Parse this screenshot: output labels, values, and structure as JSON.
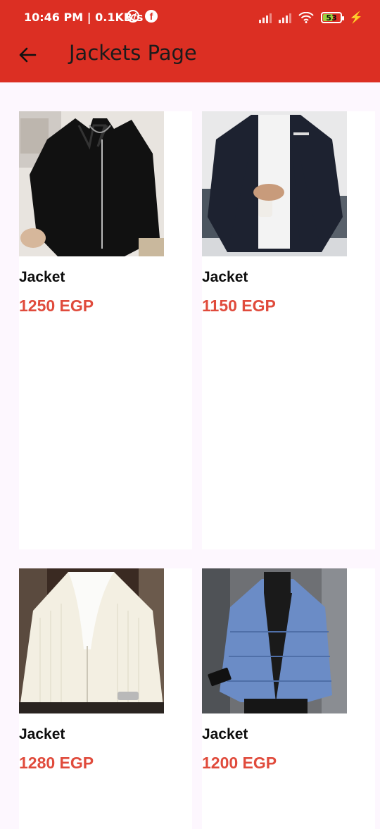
{
  "status_bar": {
    "time": "10:46 PM | 0.1KB/s",
    "battery_level": "53"
  },
  "header": {
    "title": "Jackets Page",
    "back_icon": "arrow-left-icon"
  },
  "colors": {
    "accent": "#dc2f23",
    "price": "#e04b3c",
    "background": "#fdf7fe"
  },
  "products": [
    {
      "name": "Jacket",
      "price": "1250 EGP",
      "image_icon": "black-hooded-jacket-photo"
    },
    {
      "name": "Jacket",
      "price": "1150 EGP",
      "image_icon": "black-fleece-jacket-photo"
    },
    {
      "name": "Jacket",
      "price": "1280 EGP",
      "image_icon": "cream-knit-zip-jacket-photo"
    },
    {
      "name": "Jacket",
      "price": "1200 EGP",
      "image_icon": "blue-puffer-jacket-photo"
    }
  ]
}
